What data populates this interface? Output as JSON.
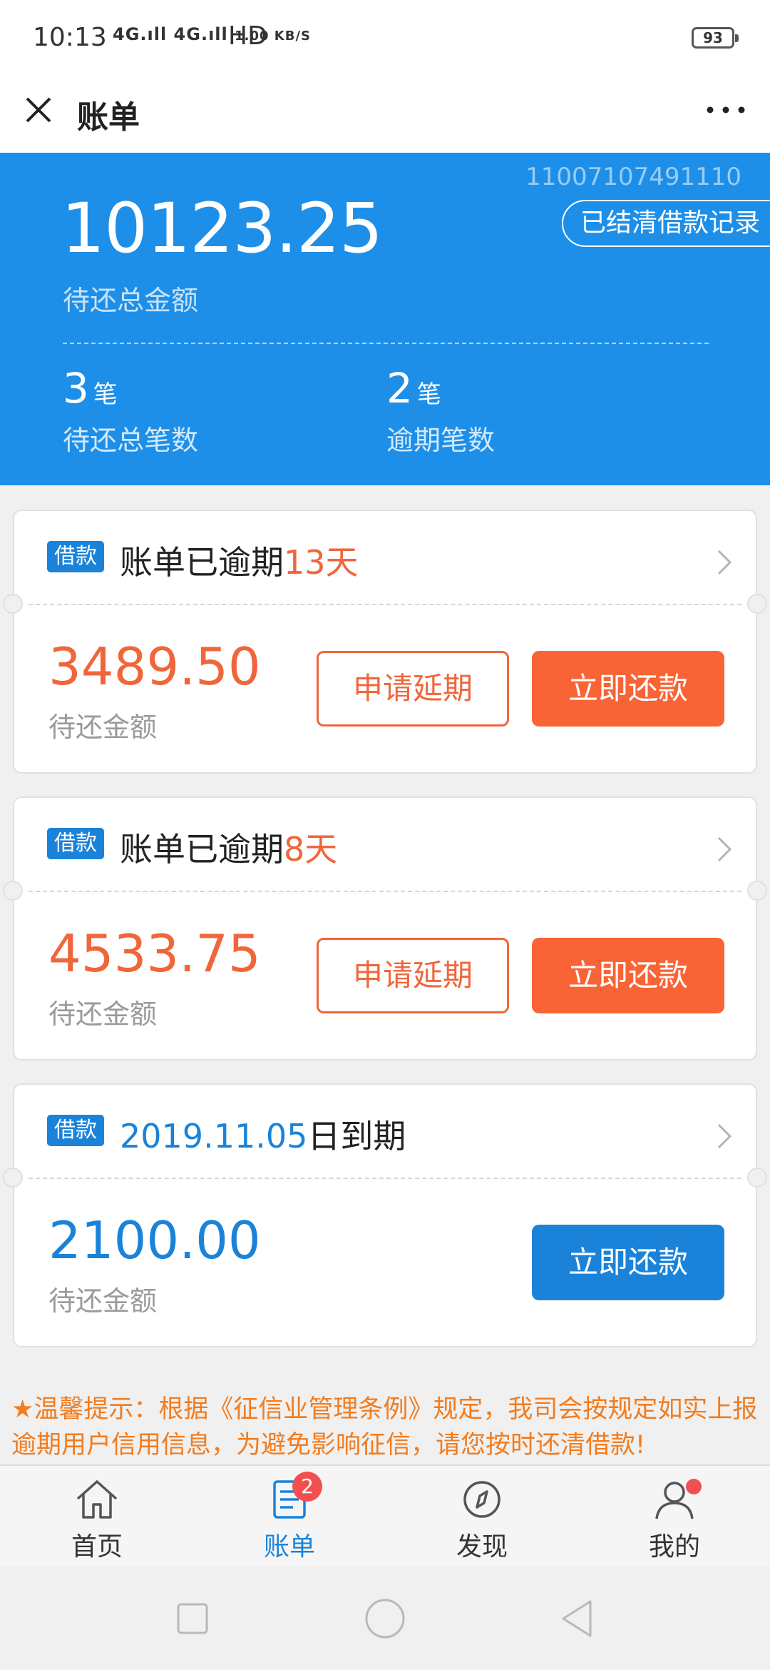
{
  "status_bar": {
    "time": "10:13",
    "network": "4G.ıll 4G.ıll",
    "speed": "1.00 KB/S",
    "hd": "HD",
    "battery": "93"
  },
  "header": {
    "title": "账单",
    "close_icon": "close-icon",
    "more_icon": "more-icon"
  },
  "summary": {
    "account_no": "11007107491110",
    "history_button": "已结清借款记录",
    "total_amount": "10123.25",
    "total_label": "待还总金额",
    "pending_count": "3",
    "pending_unit": "笔",
    "pending_label": "待还总笔数",
    "overdue_count": "2",
    "overdue_unit": "笔",
    "overdue_label": "逾期笔数"
  },
  "bills": [
    {
      "tag": "借款",
      "title_prefix": "账单已逾期",
      "title_highlight": "13天",
      "title_suffix": "",
      "amount": "3489.50",
      "amount_label": "待还金额",
      "extend_label": "申请延期",
      "pay_label": "立即还款"
    },
    {
      "tag": "借款",
      "title_prefix": "账单已逾期",
      "title_highlight": "8天",
      "title_suffix": "",
      "amount": "4533.75",
      "amount_label": "待还金额",
      "extend_label": "申请延期",
      "pay_label": "立即还款"
    },
    {
      "tag": "借款",
      "title_prefix": "",
      "title_highlight": "2019.11.05",
      "title_suffix": "日到期",
      "amount": "2100.00",
      "amount_label": "待还金额",
      "pay_label": "立即还款"
    }
  ],
  "notice": "★温馨提示：根据《征信业管理条例》规定，我司会按规定如实上报逾期用户信用信息，为避免影响征信，请您按时还清借款!",
  "tabs": [
    {
      "label": "首页",
      "icon": "home-icon"
    },
    {
      "label": "账单",
      "icon": "bill-icon",
      "badge": "2"
    },
    {
      "label": "发现",
      "icon": "compass-icon"
    },
    {
      "label": "我的",
      "icon": "user-icon"
    }
  ],
  "colors": {
    "brand_blue": "#1e8fe8",
    "accent_orange": "#f0663a",
    "badge_red": "#f25050"
  }
}
